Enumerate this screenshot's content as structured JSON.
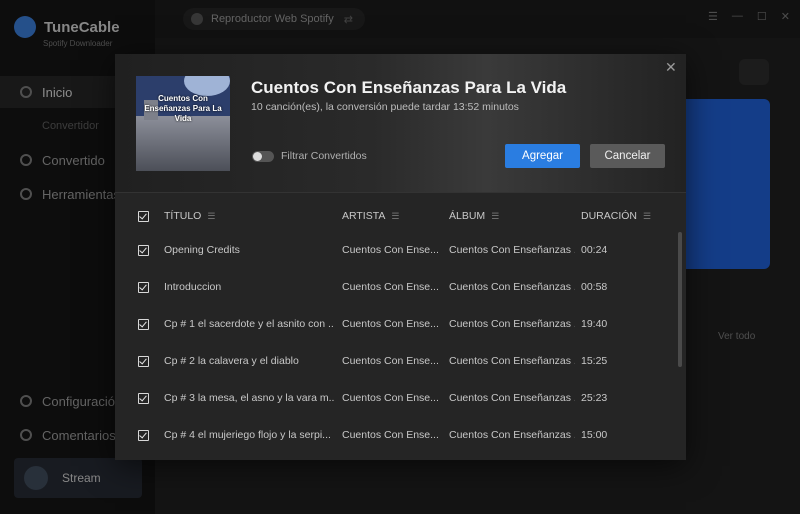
{
  "app": {
    "name": "TuneCable",
    "subtitle": "Spotify Downloader"
  },
  "sidebar": {
    "items": [
      {
        "label": "Inicio"
      },
      {
        "label": "Convertido"
      },
      {
        "label": "Herramientas"
      },
      {
        "label": "Configuración"
      },
      {
        "label": "Comentarios"
      }
    ],
    "sub_label": "Convertidor",
    "stream_label": "Stream"
  },
  "topbar": {
    "source_label": "Reproductor Web Spotify"
  },
  "main": {
    "view_all": "Ver todo"
  },
  "dialog": {
    "album_title": "Cuentos Con Enseñanzas Para La Vida",
    "cover_text": "Cuentos Con Enseñanzas Para La Vida",
    "summary": "10 canción(es), la conversión puede tardar 13:52 minutos",
    "filter_label": "Filtrar Convertidos",
    "add_label": "Agregar",
    "cancel_label": "Cancelar",
    "columns": {
      "title": "TÍTULO",
      "artist": "ARTISTA",
      "album": "ÁLBUM",
      "duration": "DURACIÓN"
    },
    "tracks": [
      {
        "title": "Opening Credits",
        "artist": "Cuentos Con Ense...",
        "album": "Cuentos Con Enseñanzas ...",
        "duration": "00:24"
      },
      {
        "title": "Introduccion",
        "artist": "Cuentos Con Ense...",
        "album": "Cuentos Con Enseñanzas ...",
        "duration": "00:58"
      },
      {
        "title": "Cp # 1 el sacerdote y el asnito con ...",
        "artist": "Cuentos Con Ense...",
        "album": "Cuentos Con Enseñanzas ...",
        "duration": "19:40"
      },
      {
        "title": "Cp # 2 la calavera y el diablo",
        "artist": "Cuentos Con Ense...",
        "album": "Cuentos Con Enseñanzas ...",
        "duration": "15:25"
      },
      {
        "title": "Cp # 3 la mesa, el asno y la vara m...",
        "artist": "Cuentos Con Ense...",
        "album": "Cuentos Con Enseñanzas ...",
        "duration": "25:23"
      },
      {
        "title": "Cp # 4 el mujeriego flojo y la serpi...",
        "artist": "Cuentos Con Ense...",
        "album": "Cuentos Con Enseñanzas ...",
        "duration": "15:00"
      }
    ]
  }
}
